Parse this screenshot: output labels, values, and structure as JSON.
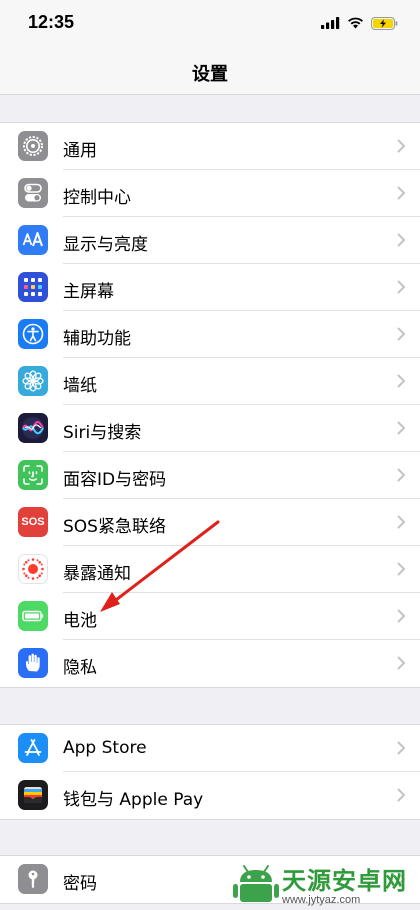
{
  "status_bar": {
    "time": "12:35"
  },
  "nav": {
    "title": "设置"
  },
  "groups": [
    {
      "items": [
        {
          "label": "通用",
          "icon": "gear-icon",
          "color": "#8e8e93"
        },
        {
          "label": "控制中心",
          "icon": "toggles-icon",
          "color": "#8e8e93"
        },
        {
          "label": "显示与亮度",
          "icon": "text-size-icon",
          "color": "#2f7cf6"
        },
        {
          "label": "主屏幕",
          "icon": "home-grid-icon",
          "color": "#2f50d8"
        },
        {
          "label": "辅助功能",
          "icon": "accessibility-icon",
          "color": "#1a7cf5"
        },
        {
          "label": "墙纸",
          "icon": "wallpaper-flower-icon",
          "color": "#36aadc"
        },
        {
          "label": "Siri与搜索",
          "icon": "siri-icon",
          "color": "#1c1c3a"
        },
        {
          "label": "面容ID与密码",
          "icon": "face-id-icon",
          "color": "#3fc35a"
        },
        {
          "label": "SOS紧急联络",
          "icon": "sos-icon",
          "color": "#e2403b",
          "icon_text": "SOS"
        },
        {
          "label": "暴露通知",
          "icon": "exposure-notification-icon",
          "color": "#ff3b30"
        },
        {
          "label": "电池",
          "icon": "battery-icon",
          "color": "#4cd964"
        },
        {
          "label": "隐私",
          "icon": "hand-icon",
          "color": "#2a6ef5"
        }
      ]
    },
    {
      "items": [
        {
          "label": "App Store",
          "icon": "app-store-icon",
          "color": "#1b8ef8"
        },
        {
          "label": "钱包与 Apple Pay",
          "icon": "wallet-icon",
          "color": "#1c1c1e"
        }
      ]
    },
    {
      "items": [
        {
          "label": "密码",
          "icon": "key-icon",
          "color": "#8e8e93"
        }
      ]
    }
  ],
  "annotation": {
    "arrow_color": "#e0211b",
    "target": "电池"
  },
  "watermark": {
    "name": "天源安卓网",
    "url": "www.jytyaz.com"
  }
}
